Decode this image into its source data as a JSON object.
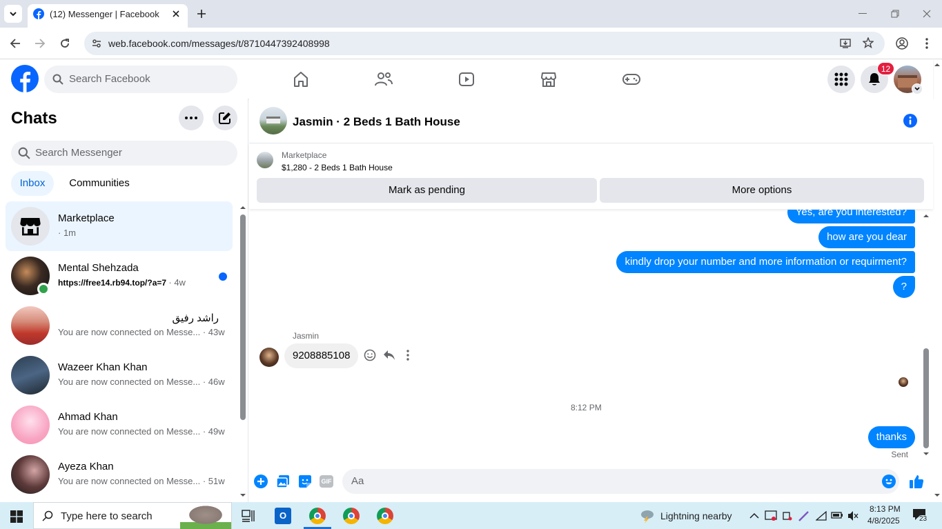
{
  "browser": {
    "tab_title": "(12) Messenger | Facebook",
    "url": "web.facebook.com/messages/t/8710447392408998"
  },
  "fb": {
    "search_placeholder": "Search Facebook",
    "notification_count": "12"
  },
  "chats": {
    "title": "Chats",
    "search_placeholder": "Search Messenger",
    "tabs": [
      "Inbox",
      "Communities"
    ],
    "items": [
      {
        "name": "Marketplace",
        "sub": "· 1m"
      },
      {
        "name": "Mental Shehzada",
        "sub": "https://free14.rb94.top/?a=7",
        "time": "· 4w"
      },
      {
        "name": "راشد رفیق",
        "sub": "You are now connected on Messe...",
        "time": "· 43w"
      },
      {
        "name": "Wazeer Khan Khan",
        "sub": "You are now connected on Messe...",
        "time": "· 46w"
      },
      {
        "name": "Ahmad Khan",
        "sub": "You are now connected on Messe...",
        "time": "· 49w"
      },
      {
        "name": "Ayeza Khan",
        "sub": "You are now connected on Messe...",
        "time": "· 51w"
      }
    ]
  },
  "conversation": {
    "title": "Jasmin · 2 Beds 1 Bath House",
    "listing_source": "Marketplace",
    "listing_title": "$1,280 - 2 Beds 1 Bath House",
    "btn_pending": "Mark as pending",
    "btn_more": "More options",
    "messages_out_top": [
      "Yes, are you interested?",
      "how are you dear",
      "kindly  drop your number and more information or requirment?",
      "?"
    ],
    "incoming_sender": "Jasmin",
    "incoming_text": "9208885108",
    "timestamp": "8:12 PM",
    "last_out": "thanks",
    "status": "Sent",
    "composer_placeholder": "Aa"
  },
  "taskbar": {
    "search_placeholder": "Type here to search",
    "weather": "Lightning nearby",
    "time": "8:13 PM",
    "date": "4/8/2025",
    "notif_count": "23"
  },
  "colors": {
    "fb_blue": "#0866ff",
    "messenger_blue": "#0084ff",
    "badge_red": "#e41e3f"
  }
}
